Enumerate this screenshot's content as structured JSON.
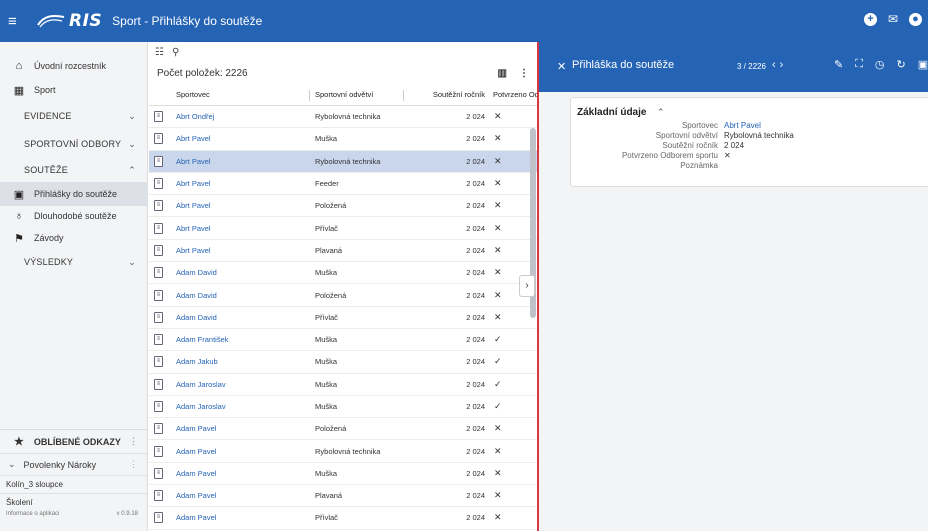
{
  "topbar": {
    "app_name": "RIS",
    "title": "Sport - Přihlášky do soutěže"
  },
  "sidebar": {
    "top_items": [
      {
        "label": "Úvodní rozcestník",
        "icon": "home-icon"
      },
      {
        "label": "Sport",
        "icon": "grid-icon"
      }
    ],
    "sections": [
      {
        "label": "EVIDENCE",
        "expanded": false
      },
      {
        "label": "SPORTOVNÍ ODBORY",
        "expanded": false
      },
      {
        "label": "SOUTĚŽE",
        "expanded": true
      }
    ],
    "sub_items": [
      {
        "label": "Přihlášky do soutěže",
        "icon": "document-icon",
        "active": true
      },
      {
        "label": "Dlouhodobé soutěže",
        "icon": "trophy-icon",
        "active": false
      },
      {
        "label": "Závody",
        "icon": "flags-icon",
        "active": false
      }
    ],
    "results_section": {
      "label": "VÝSLEDKY",
      "expanded": false
    },
    "favorites_label": "OBLÍBENÉ ODKAZY",
    "favorites_group": "Povolenky Nároky",
    "links": [
      "Kolín_3 sloupce",
      "Školení"
    ],
    "footer_left": "Informace o aplikaci",
    "footer_right": "v 0.9.18"
  },
  "list": {
    "count_label": "Počet položek: 2226",
    "columns": {
      "sportovec": "Sportovec",
      "odvetvi": "Sportovní odvětví",
      "rocnik": "Soutěžní ročník",
      "potvrzeno": "Potvrzeno Odb"
    },
    "rows": [
      {
        "name": "Abrt Ondřej",
        "odvetvi": "Rybolovná technika",
        "rocnik": "2 024",
        "potvrzeno": "✕",
        "selected": false
      },
      {
        "name": "Abrt Pavel",
        "odvetvi": "Muška",
        "rocnik": "2 024",
        "potvrzeno": "✕",
        "selected": false
      },
      {
        "name": "Abrt Pavel",
        "odvetvi": "Rybolovná technika",
        "rocnik": "2 024",
        "potvrzeno": "✕",
        "selected": true
      },
      {
        "name": "Abrt Pavel",
        "odvetvi": "Feeder",
        "rocnik": "2 024",
        "potvrzeno": "✕",
        "selected": false
      },
      {
        "name": "Abrt Pavel",
        "odvetvi": "Položená",
        "rocnik": "2 024",
        "potvrzeno": "✕",
        "selected": false
      },
      {
        "name": "Abrt Pavel",
        "odvetvi": "Přívlač",
        "rocnik": "2 024",
        "potvrzeno": "✕",
        "selected": false
      },
      {
        "name": "Abrt Pavel",
        "odvetvi": "Plavaná",
        "rocnik": "2 024",
        "potvrzeno": "✕",
        "selected": false
      },
      {
        "name": "Adam David",
        "odvetvi": "Muška",
        "rocnik": "2 024",
        "potvrzeno": "✕",
        "selected": false
      },
      {
        "name": "Adam David",
        "odvetvi": "Položená",
        "rocnik": "2 024",
        "potvrzeno": "✕",
        "selected": false
      },
      {
        "name": "Adam David",
        "odvetvi": "Přívlač",
        "rocnik": "2 024",
        "potvrzeno": "✕",
        "selected": false
      },
      {
        "name": "Adam František",
        "odvetvi": "Muška",
        "rocnik": "2 024",
        "potvrzeno": "✓",
        "selected": false
      },
      {
        "name": "Adam Jakub",
        "odvetvi": "Muška",
        "rocnik": "2 024",
        "potvrzeno": "✓",
        "selected": false
      },
      {
        "name": "Adam Jaroslav",
        "odvetvi": "Muška",
        "rocnik": "2 024",
        "potvrzeno": "✓",
        "selected": false
      },
      {
        "name": "Adam Jaroslav",
        "odvetvi": "Muška",
        "rocnik": "2 024",
        "potvrzeno": "✓",
        "selected": false
      },
      {
        "name": "Adam Pavel",
        "odvetvi": "Položená",
        "rocnik": "2 024",
        "potvrzeno": "✕",
        "selected": false
      },
      {
        "name": "Adam Pavel",
        "odvetvi": "Rybolovná technika",
        "rocnik": "2 024",
        "potvrzeno": "✕",
        "selected": false
      },
      {
        "name": "Adam Pavel",
        "odvetvi": "Muška",
        "rocnik": "2 024",
        "potvrzeno": "✕",
        "selected": false
      },
      {
        "name": "Adam Pavel",
        "odvetvi": "Plavaná",
        "rocnik": "2 024",
        "potvrzeno": "✕",
        "selected": false
      },
      {
        "name": "Adam Pavel",
        "odvetvi": "Přívlač",
        "rocnik": "2 024",
        "potvrzeno": "✕",
        "selected": false
      }
    ]
  },
  "detail": {
    "title": "Přihláška do soutěže",
    "pager": "3 / 2226",
    "section_title": "Základní údaje",
    "fields": [
      {
        "label": "Sportovec",
        "value": "Abrt Pavel",
        "link": true
      },
      {
        "label": "Sportovní odvětví",
        "value": "Rybolovná technika",
        "link": false
      },
      {
        "label": "Soutěžní ročník",
        "value": "2 024",
        "link": false
      },
      {
        "label": "Potvrzeno Odborem sportu",
        "value": "✕",
        "link": false
      },
      {
        "label": "Poznámka",
        "value": "",
        "link": false
      }
    ]
  },
  "colors": {
    "primary": "#2563b5",
    "selected_row": "#c9d6ec",
    "highlight_border": "#d8383f",
    "sidebar_bg": "#f3f4f6"
  }
}
